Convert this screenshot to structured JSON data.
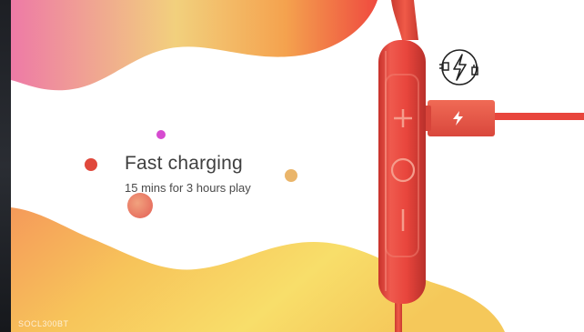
{
  "feature": {
    "title": "Fast charging",
    "subtitle": "15 mins for 3 hours play"
  },
  "model_label": "SOCL300BT",
  "icons": {
    "charging": "plug-lightning-icon",
    "volume_up": "plus-icon",
    "play_pause": "circle-button-icon",
    "volume_down": "minus-icon",
    "cable_bolt": "lightning-bolt-icon"
  },
  "colors": {
    "product_red": "#e8453c",
    "accent_dot_red": "#e0483c",
    "accent_dot_magenta": "#d64bd0",
    "accent_dot_orange": "#eab56a",
    "text": "#3f3f3f"
  }
}
